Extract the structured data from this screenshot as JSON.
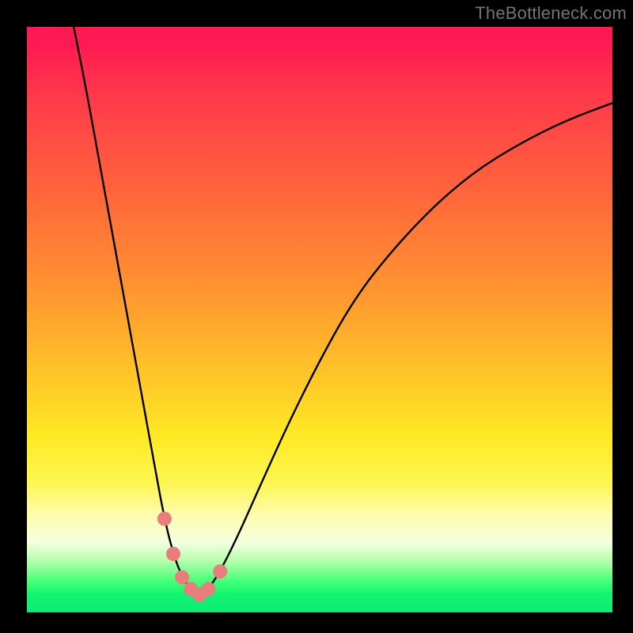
{
  "watermark": "TheBottleneck.com",
  "colors": {
    "page_bg": "#000000",
    "curve_stroke": "#000000",
    "marker_fill": "#e97d7d",
    "gradient_stops": [
      "#ff1a53",
      "#ff6a3a",
      "#ffe924",
      "#f4ffe0",
      "#0eec74"
    ]
  },
  "chart_data": {
    "type": "line",
    "title": "",
    "xlabel": "",
    "ylabel": "",
    "xlim": [
      0,
      100
    ],
    "ylim": [
      0,
      100
    ],
    "x": [
      8,
      10,
      12,
      14,
      16,
      18,
      20,
      22,
      23.5,
      25,
      26.5,
      28,
      29.5,
      31,
      33,
      36,
      40,
      45,
      50,
      55,
      60,
      68,
      76,
      84,
      92,
      100
    ],
    "values": [
      100,
      90,
      79,
      68,
      57,
      46,
      35,
      24,
      16,
      10,
      6,
      4,
      3,
      4,
      7,
      13,
      22,
      33,
      43,
      52,
      59,
      68,
      75,
      80,
      84,
      87
    ],
    "markers": {
      "x": [
        23.5,
        25,
        26.5,
        28,
        29.5,
        31,
        33
      ],
      "y": [
        16,
        10,
        6,
        4,
        3,
        4,
        7
      ]
    },
    "note": "Values are estimated from pixel positions; the chart has no visible tick labels so x and y are normalized 0-100 over the plot area. The curve dips to a minimum near x≈29 (y≈3) with small pink markers clustered around the trough."
  }
}
